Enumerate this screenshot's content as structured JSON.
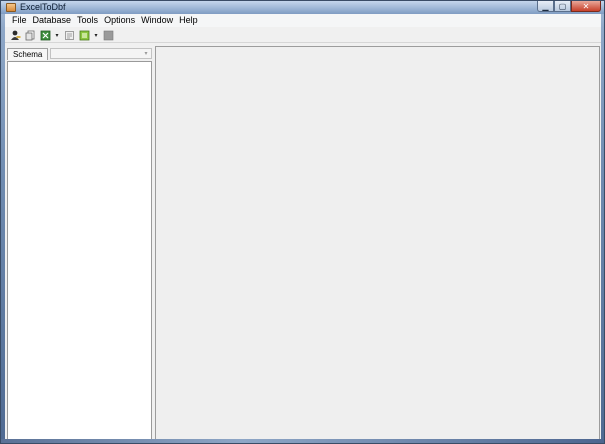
{
  "window": {
    "title": "ExcelToDbf",
    "controls": {
      "minimize": "▁",
      "maximize": "▢",
      "close": "✕"
    }
  },
  "menubar": {
    "items": [
      "File",
      "Database",
      "Tools",
      "Options",
      "Window",
      "Help"
    ]
  },
  "toolbar": {
    "buttons": [
      {
        "icon": "connect-user-icon"
      },
      {
        "icon": "copy-document-icon"
      },
      {
        "icon": "export-sheet-icon",
        "has_dropdown": true
      },
      {
        "icon": "notes-icon"
      },
      {
        "icon": "green-sheet-icon",
        "has_dropdown": true
      },
      {
        "icon": "stop-icon"
      }
    ],
    "dropdown_glyph": "▾"
  },
  "left_panel": {
    "schema_tab_label": "Schema",
    "schema_combo_value": "",
    "combo_arrow": "▾"
  },
  "colors": {
    "client_bg": "#f0f0f0",
    "workspace_bg": "#efefef",
    "list_bg": "#ffffff"
  }
}
